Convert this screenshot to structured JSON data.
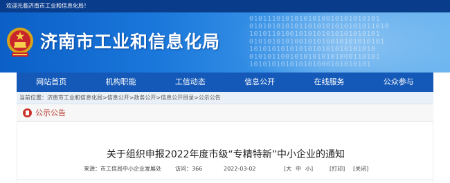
{
  "top_bar": {
    "welcome": "欢迎光临济南市工业和信息化局！"
  },
  "header": {
    "title": "济南市工业和信息化局",
    "binary_pattern": "01011101010101010010101010101\n0101010101011010101010101011010\n10101101001010101010101010101\n010101010100101010010101010101\n1010101010101010101010101010\n01010110010101010101000110101\n101010101010101000101010101"
  },
  "nav": {
    "items": [
      {
        "label": "网站首页"
      },
      {
        "label": "机构职能"
      },
      {
        "label": "工信动态"
      },
      {
        "label": "信息公开"
      },
      {
        "label": "在线服务"
      },
      {
        "label": "公众参与"
      }
    ]
  },
  "breadcrumb": {
    "text": "当前位置：济南市工业和信息化局>信息公开>政务公开>信息公开目录>公示公告"
  },
  "section": {
    "title": "公示公告"
  },
  "article": {
    "title": "关于组织申报2022年度市级“专精特新”中小企业的通知",
    "source": "来源：市工信局中小企业发展处",
    "views": "访问：366",
    "date": "2022-03-02",
    "font_size_large": "[大",
    "font_size_medium": "中",
    "font_size_small": "小]",
    "print": "[打印]",
    "close": "[关闭]"
  },
  "colors": {
    "top_bar": "#0a3c8c",
    "nav": "#1559b8",
    "section_accent": "#b7392f"
  }
}
